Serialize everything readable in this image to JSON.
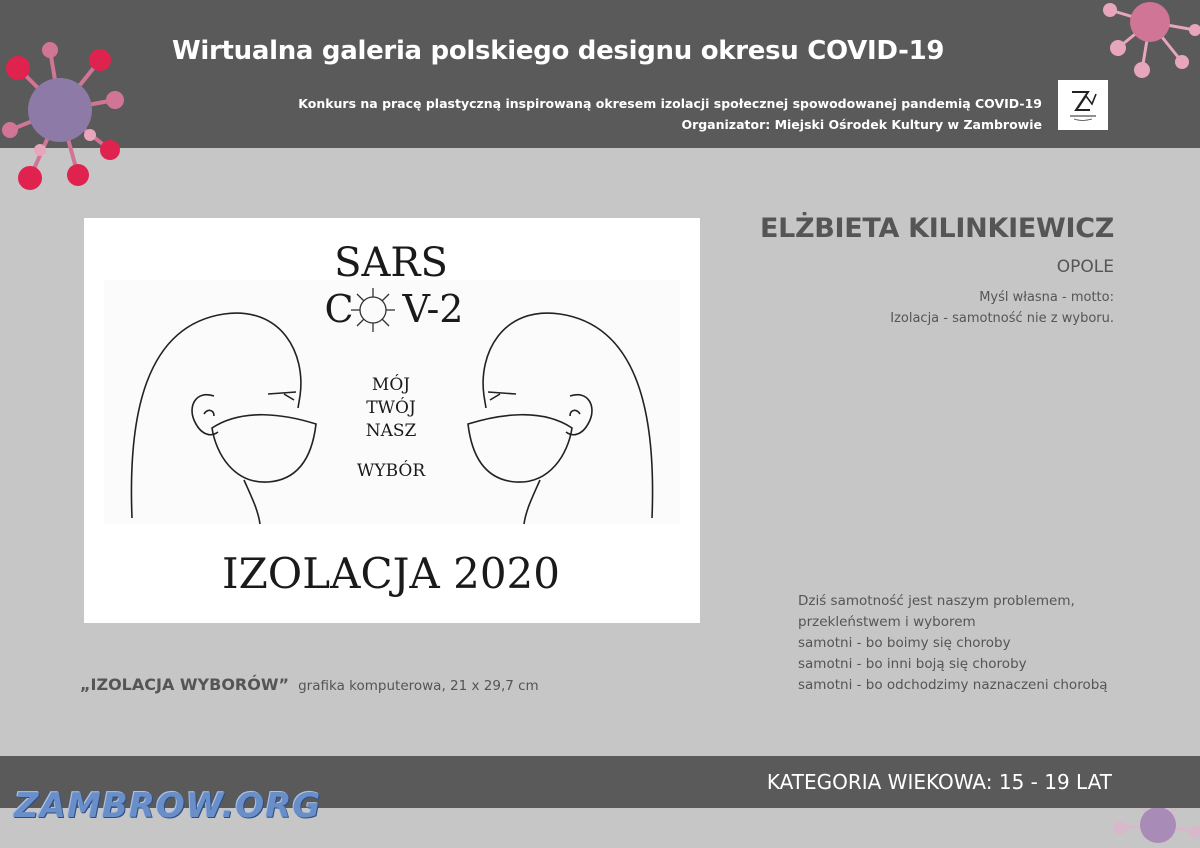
{
  "header": {
    "title": "Wirtualna galeria polskiego designu okresu COVID-19",
    "subtitle_line1": "Konkurs na pracę plastyczną inspirowaną okresem izolacji społecznej spowodowanej pandemią COVID-19",
    "subtitle_line2": "Organizator: Miejski Ośrodek Kultury w Zambrowie"
  },
  "artwork": {
    "line1": "SARS",
    "line2_prefix": "C",
    "line2_suffix": "V-2",
    "center_line1": "MÓJ",
    "center_line2": "TWÓJ",
    "center_line3": "NASZ",
    "center_line4": "WYBÓR",
    "bottom": "IZOLACJA 2020"
  },
  "author": {
    "name": "ELŻBIETA KILINKIEWICZ",
    "city": "OPOLE",
    "motto_line1": "Myśl własna - motto:",
    "motto_line2": "Izolacja - samotność nie z wyboru."
  },
  "poem": [
    "Dziś samotność jest naszym problemem,",
    "przekleństwem i wyborem",
    "samotni - bo boimy się choroby",
    "samotni - bo inni boją się choroby",
    "samotni - bo odchodzimy naznaczeni chorobą"
  ],
  "caption": {
    "title": "„IZOLACJA WYBORÓW”",
    "description": "grafika komputerowa,  21 x 29,7 cm"
  },
  "footer": {
    "category": "KATEGORIA WIEKOWA: 15 - 19 LAT"
  },
  "watermark": "ZAMBROW.ORG",
  "colors": {
    "band": "#5a5a5a",
    "background": "#c6c6c6",
    "virus_core": "#8e7aa6",
    "virus_red": "#e0234e",
    "virus_pink": "#d07595",
    "virus_light": "#e8a6bd"
  }
}
